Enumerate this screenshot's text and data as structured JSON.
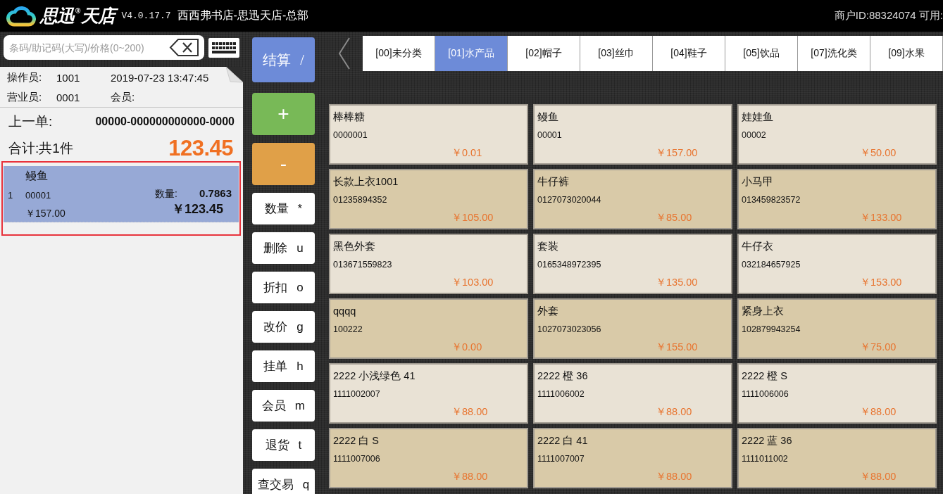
{
  "header": {
    "brand": "思迅$^{®}$天店",
    "version": "V4.0.17.7",
    "store": "西西弗书店-思迅天店-总部",
    "merchant": "商户ID:88324074 可用:"
  },
  "search": {
    "placeholder": "条码/助记码(大写)/价格(0~200)"
  },
  "receipt": {
    "operator_label": "操作员:",
    "operator": "1001",
    "datetime": "2019-07-23 13:47:45",
    "clerk_label": "营业员:",
    "clerk": "0001",
    "member_label": "会员:",
    "last_order_label": "上一单:",
    "last_order": "00000-000000000000-0000",
    "total_label": "合计:共1件",
    "total": "123.45",
    "items": [
      {
        "index": "1",
        "name": "鳗鱼",
        "code": "00001",
        "price": "￥157.00",
        "qty_label": "数量:",
        "qty": "0.7863",
        "amount": "￥123.45",
        "selected": true
      }
    ]
  },
  "actions": [
    {
      "label": "结算 /",
      "kind": "checkout"
    },
    {
      "label": "+",
      "kind": "add"
    },
    {
      "label": "-",
      "kind": "subtract"
    },
    {
      "label": "数量 *",
      "kind": "function"
    },
    {
      "label": "删除 u",
      "kind": "function"
    },
    {
      "label": "折扣 o",
      "kind": "function"
    },
    {
      "label": "改价 g",
      "kind": "function"
    },
    {
      "label": "挂单 h",
      "kind": "function"
    },
    {
      "label": "会员 m",
      "kind": "function"
    },
    {
      "label": "退货 t",
      "kind": "function"
    },
    {
      "label": "查交易 q",
      "kind": "function"
    }
  ],
  "categories": [
    {
      "label": "[00]未分类",
      "selected": false
    },
    {
      "label": "[01]水产品",
      "selected": true
    },
    {
      "label": "[02]帽子",
      "selected": false
    },
    {
      "label": "[03]丝巾",
      "selected": false
    },
    {
      "label": "[04]鞋子",
      "selected": false
    },
    {
      "label": "[05]饮品",
      "selected": false
    },
    {
      "label": "[07]洗化类",
      "selected": false
    },
    {
      "label": "[09]水果",
      "selected": false
    }
  ],
  "products": [
    {
      "name": "棒棒糖",
      "code": "0000001",
      "price": "￥0.01"
    },
    {
      "name": "鳗鱼",
      "code": "00001",
      "price": "￥157.00"
    },
    {
      "name": "娃娃鱼",
      "code": "00002",
      "price": "￥50.00"
    },
    {
      "name": "长款上衣1001",
      "code": "01235894352",
      "price": "￥105.00"
    },
    {
      "name": "牛仔裤",
      "code": "0127073020044",
      "price": "￥85.00"
    },
    {
      "name": "小马甲",
      "code": "013459823572",
      "price": "￥133.00"
    },
    {
      "name": "黑色外套",
      "code": "013671559823",
      "price": "￥103.00"
    },
    {
      "name": "套装",
      "code": "0165348972395",
      "price": "￥135.00"
    },
    {
      "name": "牛仔衣",
      "code": "032184657925",
      "price": "￥153.00"
    },
    {
      "name": "qqqq",
      "code": "100222",
      "price": "￥0.00"
    },
    {
      "name": "外套",
      "code": "1027073023056",
      "price": "￥155.00"
    },
    {
      "name": "紧身上衣",
      "code": "102879943254",
      "price": "￥75.00"
    },
    {
      "name": "2222 小浅绿色 41",
      "code": "1111002007",
      "price": "￥88.00"
    },
    {
      "name": "2222 橙 36",
      "code": "1111006002",
      "price": "￥88.00"
    },
    {
      "name": "2222 橙 S",
      "code": "1111006006",
      "price": "￥88.00"
    },
    {
      "name": "2222 白 S",
      "code": "1111007006",
      "price": "￥88.00"
    },
    {
      "name": "2222 白 41",
      "code": "1111007007",
      "price": "￥88.00"
    },
    {
      "name": "2222 蓝 36",
      "code": "1111011002",
      "price": "￥88.00"
    }
  ]
}
